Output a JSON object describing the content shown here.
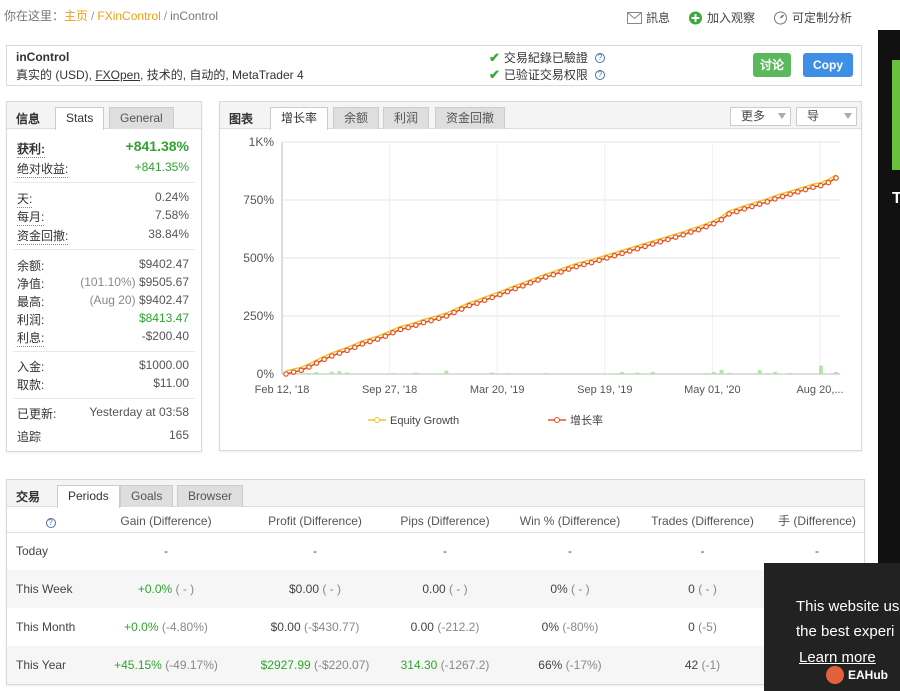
{
  "breadcrumb": {
    "prefix": "你在这里：",
    "home": "主页",
    "section": "FXinControl",
    "current": "inControl"
  },
  "top_actions": {
    "message": "訊息",
    "watch": "加入观察",
    "custom": "可定制分析"
  },
  "header": {
    "title": "inControl",
    "subtitle_pre": "真实的 (USD), ",
    "broker": "FXOpen",
    "subtitle_post": ", 技术的, 自动的, MetaTrader 4",
    "verify1": "交易紀錄已驗證",
    "verify2": "已验证交易权限",
    "discuss_label": "讨论",
    "copy_label": "Copy"
  },
  "info": {
    "tab_title": "信息",
    "tabs": [
      "Stats",
      "General"
    ],
    "gain_label": "获利:",
    "gain_value": "+841.38%",
    "abs_gain_label": "绝对收益:",
    "abs_gain_value": "+841.35%",
    "daily_label": "天:",
    "daily_value": "0.24%",
    "monthly_label": "每月:",
    "monthly_value": "7.58%",
    "drawdown_label": "资金回撤:",
    "drawdown_value": "38.84%",
    "balance_label": "余额:",
    "balance_value": "$9402.47",
    "equity_label": "净值:",
    "equity_pct": "(101.10%)",
    "equity_value": "$9505.67",
    "highest_label": "最高:",
    "highest_date": "(Aug 20)",
    "highest_value": "$9402.47",
    "profit_label": "利润:",
    "profit_value": "$8413.47",
    "interest_label": "利息:",
    "interest_value": "-$200.40",
    "deposits_label": "入金:",
    "deposits_value": "$1000.00",
    "withdrawals_label": "取款:",
    "withdrawals_value": "$11.00",
    "updated_label": "已更新:",
    "updated_value": "Yesterday at 03:58",
    "tracking_label": "追踪",
    "tracking_value": "165"
  },
  "chart_panel": {
    "tab_title": "图表",
    "tabs": [
      "增长率",
      "余额",
      "利润",
      "资金回撤"
    ],
    "more_label": "更多",
    "export_label": "导"
  },
  "chart_data": {
    "type": "line",
    "ylim": [
      0,
      1000
    ],
    "y_ticks": [
      "0%",
      "250%",
      "500%",
      "750%",
      "1K%"
    ],
    "y_tick_values": [
      0,
      250,
      500,
      750,
      1000
    ],
    "x_ticks": [
      "Feb 12, '18",
      "Sep 27, '18",
      "Mar 20, '19",
      "Sep 19, '19",
      "May 01, '20",
      "Aug 20,..."
    ],
    "grid": true,
    "legend_position": "bottom",
    "series": [
      {
        "name": "Equity Growth",
        "color": "#f2c12e"
      },
      {
        "name": "增长率",
        "color": "#e8501e"
      }
    ],
    "growth_values": [
      0,
      8,
      16,
      30,
      47,
      63,
      78,
      90,
      102,
      115,
      130,
      140,
      150,
      163,
      178,
      192,
      200,
      210,
      222,
      230,
      240,
      250,
      265,
      280,
      295,
      305,
      318,
      330,
      342,
      355,
      368,
      380,
      393,
      405,
      418,
      428,
      440,
      452,
      463,
      472,
      480,
      490,
      500,
      510,
      520,
      530,
      540,
      550,
      560,
      570,
      580,
      590,
      600,
      612,
      622,
      635,
      648,
      665,
      690,
      700,
      712,
      722,
      732,
      742,
      755,
      765,
      775,
      785,
      795,
      805,
      812,
      825,
      845
    ],
    "bar_values": [
      2,
      3,
      1,
      4,
      8,
      2,
      10,
      12,
      6,
      3,
      1,
      2,
      3,
      1,
      4,
      1,
      2,
      6,
      2,
      3,
      1,
      14,
      2,
      1,
      3,
      1,
      1,
      6,
      3,
      4,
      1,
      2,
      1,
      3,
      4,
      1,
      2,
      3,
      1,
      2,
      1,
      1,
      2,
      3,
      9,
      3,
      6,
      3,
      9,
      3,
      1,
      2,
      1,
      1,
      2,
      4,
      8,
      18,
      5,
      2,
      1,
      3,
      17,
      4,
      9,
      2,
      4,
      1,
      3,
      2,
      36,
      2,
      9
    ]
  },
  "trades": {
    "tab_title": "交易",
    "tabs": [
      "Periods",
      "Goals",
      "Browser"
    ],
    "columns": [
      "Gain (Difference)",
      "Profit (Difference)",
      "Pips (Difference)",
      "Win % (Difference)",
      "Trades (Difference)",
      "手 (Difference)"
    ],
    "rows": [
      {
        "period": "Today",
        "gain": "-",
        "gain_diff": "",
        "profit": "-",
        "profit_diff": "",
        "pips": "-",
        "pips_diff": "",
        "win": "-",
        "win_diff": "",
        "trades": "-",
        "trades_diff": "",
        "lots": "-",
        "lots_diff": ""
      },
      {
        "period": "This Week",
        "gain": "+0.0%",
        "gain_diff": "( - )",
        "profit": "$0.00",
        "profit_diff": "( - )",
        "pips": "0.00",
        "pips_diff": "( - )",
        "win": "0%",
        "win_diff": "( - )",
        "trades": "0",
        "trades_diff": "( - )",
        "lots": "",
        "lots_diff": ""
      },
      {
        "period": "This Month",
        "gain": "+0.0%",
        "gain_diff": "(-4.80%)",
        "profit": "$0.00",
        "profit_diff": "(-$430.77)",
        "pips": "0.00",
        "pips_diff": "(-212.2)",
        "win": "0%",
        "win_diff": "(-80%)",
        "trades": "0",
        "trades_diff": "(-5)",
        "lots": "",
        "lots_diff": ""
      },
      {
        "period": "This Year",
        "gain": "+45.15%",
        "gain_diff": "(-49.17%)",
        "profit": "$2927.99",
        "profit_diff": "(-$220.07)",
        "pips": "314.30",
        "pips_diff": "(-1267.2)",
        "win": "66%",
        "win_diff": "(-17%)",
        "trades": "42",
        "trades_diff": "(-1)",
        "lots": "",
        "lots_diff": ""
      }
    ]
  },
  "cookie": {
    "line1": "This website us",
    "line2": "the best experi",
    "learn_more": "Learn more"
  },
  "ad": {
    "letter": "T"
  },
  "watermark": "EAHub"
}
